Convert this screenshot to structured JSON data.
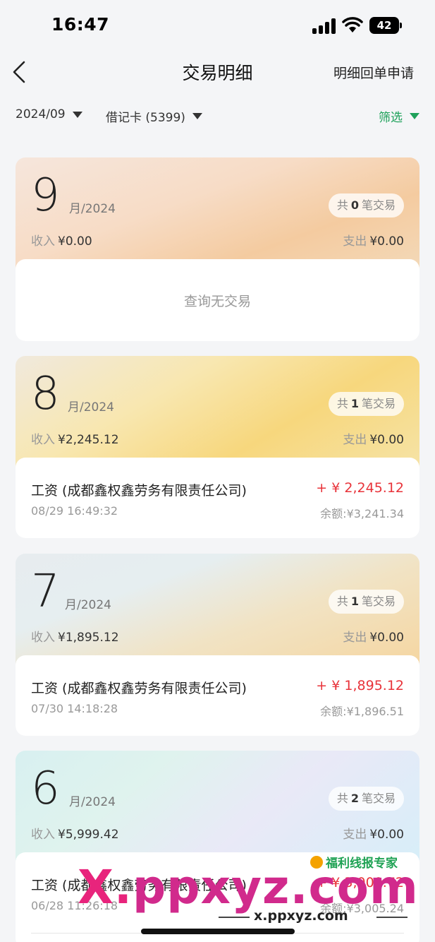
{
  "status": {
    "time": "16:47",
    "battery": "42"
  },
  "nav": {
    "title": "交易明细",
    "right_action": "明细回单申请"
  },
  "filters": {
    "date": "2024/09",
    "card": "借记卡 (5399)",
    "screen": "筛选"
  },
  "labels": {
    "income": "收入",
    "expense": "支出",
    "count_prefix": "共",
    "count_suffix": "笔交易",
    "balance": "余额:"
  },
  "months": [
    {
      "month": "9",
      "year": "月/2024",
      "count": "0",
      "income": "¥0.00",
      "expense": "¥0.00",
      "empty": "查询无交易",
      "transactions": []
    },
    {
      "month": "8",
      "year": "月/2024",
      "count": "1",
      "income": "¥2,245.12",
      "expense": "¥0.00",
      "transactions": [
        {
          "name": "工资 (成都鑫权鑫劳务有限责任公司)",
          "amount": "+ ¥ 2,245.12",
          "date": "08/29 16:49:32",
          "balance": "¥3,241.34"
        }
      ]
    },
    {
      "month": "7",
      "year": "月/2024",
      "count": "1",
      "income": "¥1,895.12",
      "expense": "¥0.00",
      "transactions": [
        {
          "name": "工资 (成都鑫权鑫劳务有限责任公司)",
          "amount": "+ ¥ 1,895.12",
          "date": "07/30 14:18:28",
          "balance": "¥1,896.51"
        }
      ]
    },
    {
      "month": "6",
      "year": "月/2024",
      "count": "2",
      "income": "¥5,999.42",
      "expense": "¥0.00",
      "transactions": [
        {
          "name": "工资 (成都鑫权鑫劳务有限责任公司)",
          "amount": "+ ¥ 3,000.72",
          "date": "06/28 11:26:18",
          "balance": "¥3,005.24"
        }
      ]
    }
  ],
  "watermark": {
    "x": "X.",
    "rest": "ppxyz.com",
    "tag": "福利线报专家",
    "url": "x.ppxyz.com"
  }
}
